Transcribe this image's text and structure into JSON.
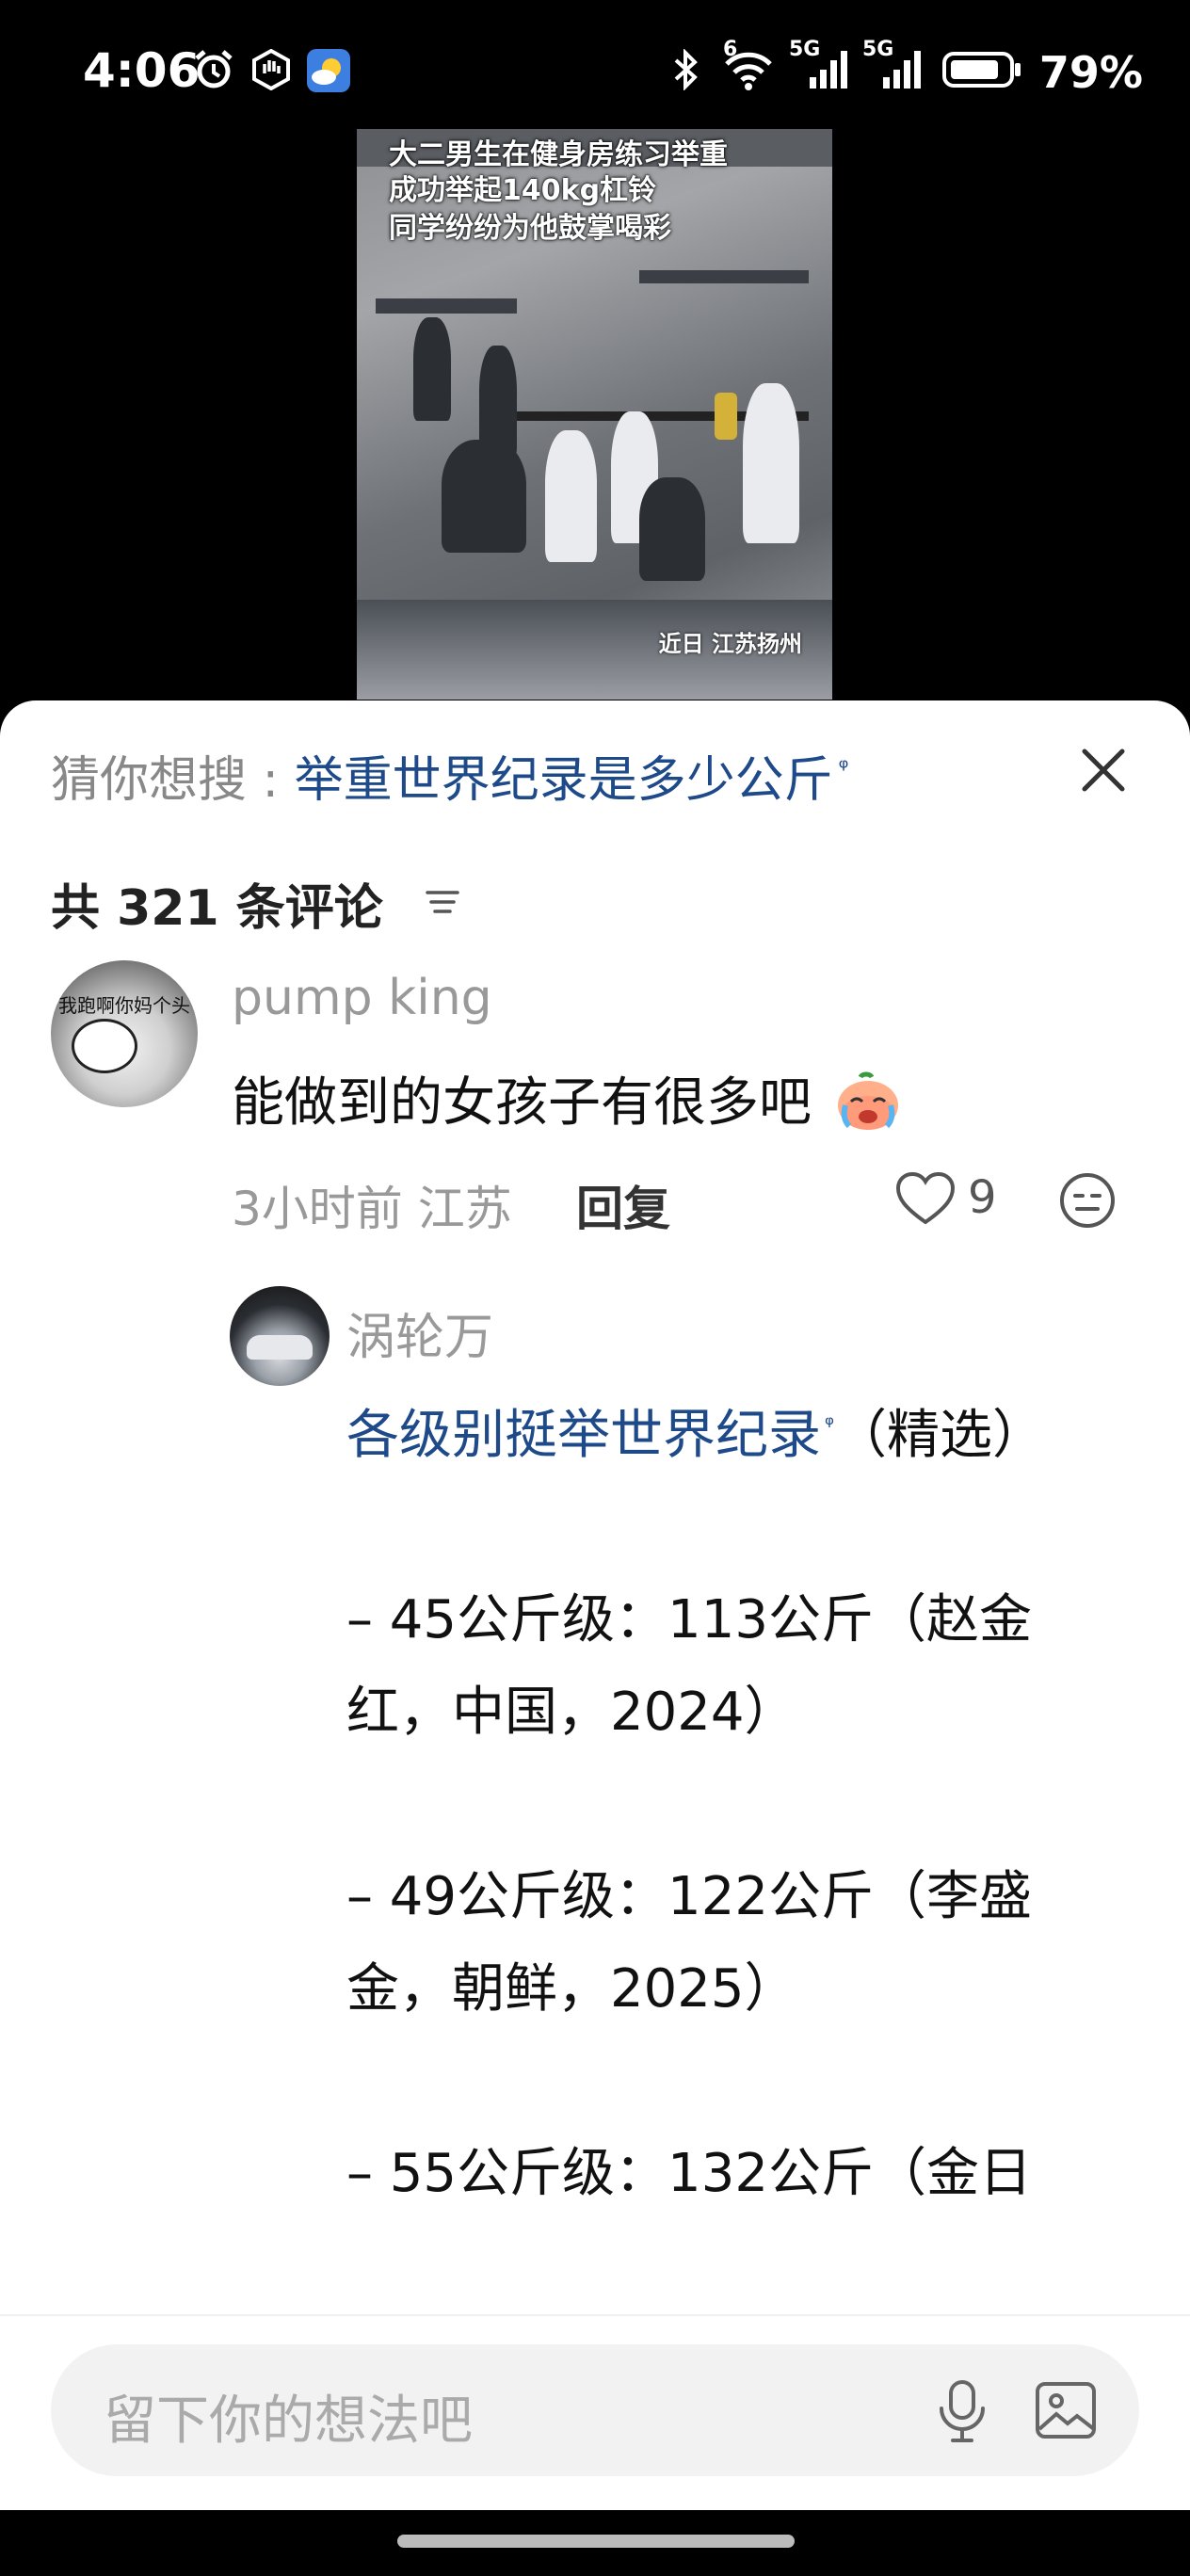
{
  "status_bar": {
    "time": "4:06",
    "net_1": "6",
    "net_2": "5G",
    "net_3": "5G",
    "battery": "79%"
  },
  "video": {
    "caption_line1": "大二男生在健身房练习举重",
    "caption_line2": "成功举起140kg杠铃",
    "caption_line3": "同学纷纷为他鼓掌喝彩",
    "location_tag": "近日 江苏扬州"
  },
  "search_suggestion": {
    "label": "猜你想搜 : ",
    "query": "举重世界纪录是多少公斤",
    "query_icon": "ᵠ"
  },
  "comments_header": {
    "count_text": "共 321 条评论"
  },
  "comment": {
    "avatar_text": "我跑啊你妈个头",
    "username": "pump king",
    "text": "能做到的女孩子有很多吧",
    "emoji": "crying-face-emoji",
    "time_location": "3小时前 江苏",
    "reply_label": "回复",
    "like_count": "9"
  },
  "reply": {
    "username": "涡轮万",
    "link_text": "各级别挺举世界纪录",
    "link_icon": "ᵠ",
    "after_link": "（精选）",
    "line1a": "– 45公斤级：113公斤（赵金",
    "line1b": "红，中国，2024）",
    "line2a": "– 49公斤级：122公斤（李盛",
    "line2b": "金，朝鲜，2025）",
    "line3a": "– 55公斤级：132公斤（金日"
  },
  "input_bar": {
    "placeholder": "留下你的想法吧"
  },
  "colors": {
    "link": "#1e4a8a",
    "muted": "#999999",
    "background": "#ffffff"
  }
}
